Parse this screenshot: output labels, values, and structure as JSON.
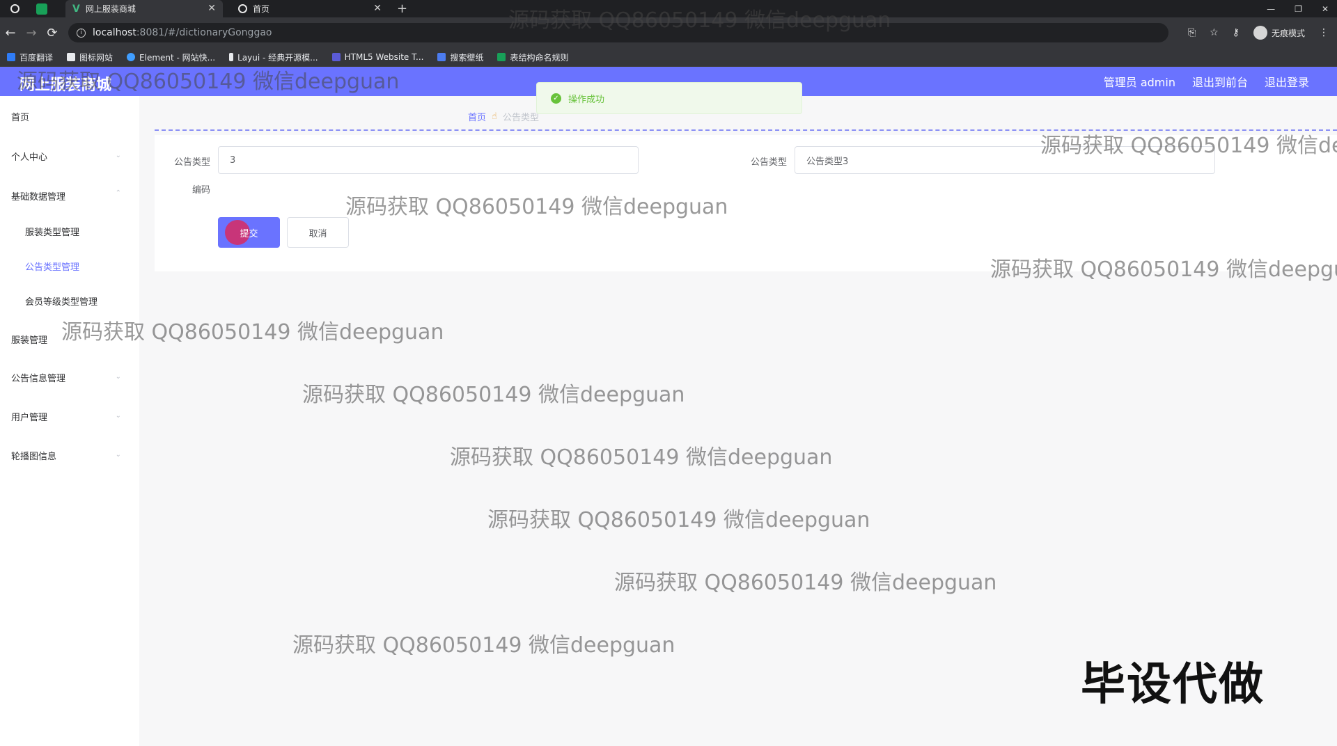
{
  "browser": {
    "tabs": [
      {
        "label": "网上服装商城"
      },
      {
        "label": "首页"
      }
    ],
    "url_host": "localhost",
    "url_path": ":8081/#/dictionaryGonggao",
    "incognito_label": "无痕模式",
    "bookmarks": [
      {
        "label": "百度翻译",
        "color": "#2f7cf6"
      },
      {
        "label": "图标网站",
        "color": "#e8eaed"
      },
      {
        "label": "Element - 网站快...",
        "color": "#409eff"
      },
      {
        "label": "Layui - 经典开源模...",
        "color": "#e8eaed"
      },
      {
        "label": "HTML5 Website T...",
        "color": "#5b5bd6"
      },
      {
        "label": "搜索壁纸",
        "color": "#4c7cf0"
      },
      {
        "label": "表结构命名规则",
        "color": "#18a058"
      }
    ]
  },
  "header": {
    "title": "网上服装商城",
    "admin_label": "管理员 admin",
    "front_label": "退出到前台",
    "logout_label": "退出登录"
  },
  "sidebar": {
    "items": [
      {
        "label": "首页"
      },
      {
        "label": "个人中心"
      },
      {
        "label": "基础数据管理"
      },
      {
        "label": "服装类型管理"
      },
      {
        "label": "公告类型管理"
      },
      {
        "label": "会员等级类型管理"
      },
      {
        "label": "服装管理"
      },
      {
        "label": "公告信息管理"
      },
      {
        "label": "用户管理"
      },
      {
        "label": "轮播图信息"
      }
    ]
  },
  "breadcrumb": {
    "home": "首页",
    "current": "公告类型"
  },
  "form": {
    "code_label": "公告类型",
    "code_label_2": "编码",
    "code_value": "3",
    "name_label": "公告类型",
    "name_value": "公告类型3",
    "submit_label": "提交",
    "cancel_label": "取消"
  },
  "toast": {
    "message": "操作成功"
  },
  "watermark": {
    "text": "源码获取 QQ86050149 微信deepguan",
    "stamp": "毕设代做"
  },
  "colors": {
    "accent": "#6a73ff",
    "success": "#67c23a"
  }
}
